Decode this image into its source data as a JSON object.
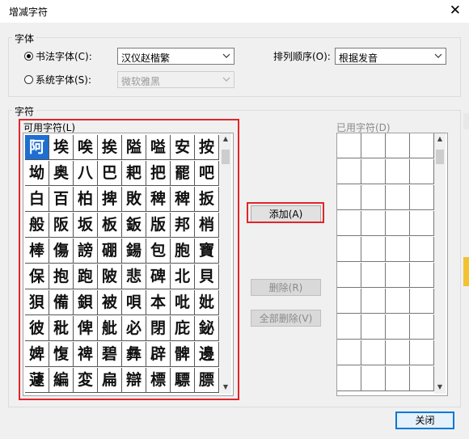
{
  "window": {
    "title": "增减字符",
    "close_icon": "close-icon"
  },
  "font_group": {
    "label": "字体",
    "calligraphy_radio_label": "书法字体(C):",
    "calligraphy_font": "汉仪赵楷繁",
    "system_radio_label": "系统字体(S):",
    "system_font": "微软雅黑",
    "sort_label": "排列顺序(O):",
    "sort_value": "根据发音",
    "calligraphy_selected": true
  },
  "char_group": {
    "label": "字符",
    "available_label": "可用字符(L)",
    "used_label": "已用字符(D)",
    "available_chars": [
      [
        "阿",
        "埃",
        "唉",
        "挨",
        "隘",
        "嗌",
        "安",
        "按"
      ],
      [
        "坳",
        "奥",
        "八",
        "巴",
        "耙",
        "把",
        "罷",
        "吧"
      ],
      [
        "白",
        "百",
        "柏",
        "捭",
        "敗",
        "稗",
        "稗",
        "扳"
      ],
      [
        "般",
        "阪",
        "坂",
        "板",
        "鈑",
        "版",
        "邦",
        "梢"
      ],
      [
        "棒",
        "傷",
        "謗",
        "硼",
        "鍚",
        "包",
        "胞",
        "寶"
      ],
      [
        "保",
        "抱",
        "跑",
        "陂",
        "悲",
        "碑",
        "北",
        "貝"
      ],
      [
        "狽",
        "備",
        "鋇",
        "被",
        "唄",
        "本",
        "吡",
        "妣"
      ],
      [
        "彼",
        "秕",
        "俾",
        "舭",
        "必",
        "閉",
        "庇",
        "鉍"
      ],
      [
        "婢",
        "愎",
        "禆",
        "碧",
        "彝",
        "辟",
        "髀",
        "邊"
      ],
      [
        "蘧",
        "編",
        "変",
        "扁",
        "辯",
        "標",
        "驃",
        "膘"
      ]
    ],
    "selected_char": "阿"
  },
  "buttons": {
    "add": "添加(A)",
    "delete": "删除(R)",
    "delete_all": "全部删除(V)",
    "close": "关闭"
  }
}
